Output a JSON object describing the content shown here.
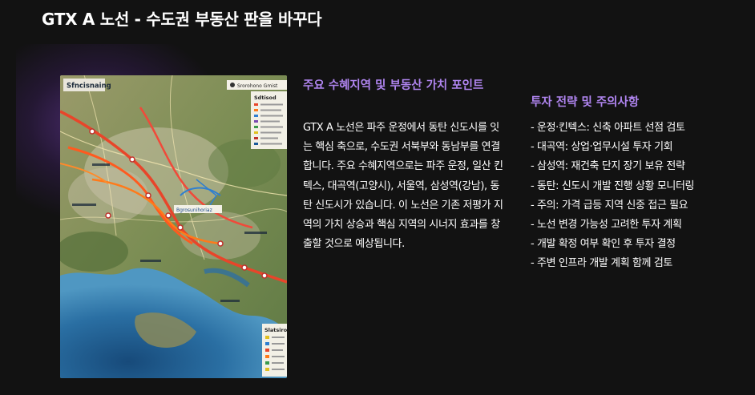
{
  "page": {
    "title": "GTX A 노선 - 수도권 부동산 판을 바꾸다",
    "accent_color": "#b085f0",
    "background_color": "#121212"
  },
  "map_image": {
    "header_left": "Sfncisnaing",
    "header_right": "Srorohono Gmist",
    "legend_top_title": "Sdtisod",
    "legend_bottom_title": "Slatsiroa",
    "callout": "Bgrosunihoriaz"
  },
  "left_column": {
    "heading": "주요 수혜지역 및 부동산 가치 포인트",
    "body": "GTX A 노선은 파주 운정에서 동탄 신도시를 잇는 핵심 축으로, 수도권 서북부와 동남부를 연결합니다. 주요 수혜지역으로는 파주 운정, 일산 킨텍스, 대곡역(고양시), 서울역, 삼성역(강남), 동탄 신도시가 있습니다. 이 노선은 기존 저평가 지역의 가치 상승과 핵심 지역의 시너지 효과를 창출할 것으로 예상됩니다."
  },
  "right_column": {
    "heading": "투자 전략 및 주의사항",
    "items": [
      "- 운정·킨텍스: 신축 아파트 선점 검토",
      "- 대곡역: 상업·업무시설 투자 기회",
      "- 삼성역: 재건축 단지 장기 보유 전략",
      "- 동탄: 신도시 개발 진행 상황 모니터링",
      "- 주의: 가격 급등 지역 신중 접근 필요",
      "- 노선 변경 가능성 고려한 투자 계획",
      "- 개발 확정 여부 확인 후 투자 결정",
      "- 주변 인프라 개발 계획 함께 검토"
    ]
  }
}
